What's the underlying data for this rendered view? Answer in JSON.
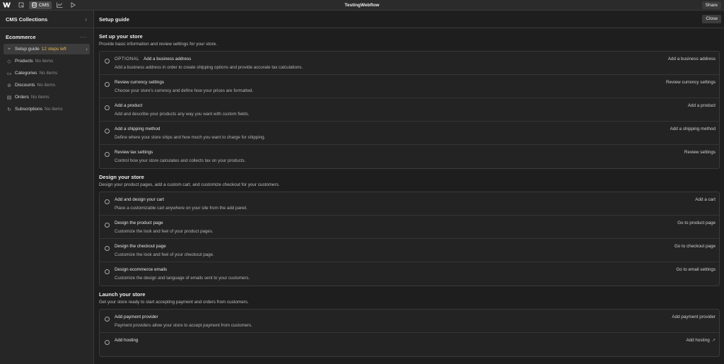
{
  "topbar": {
    "logo": "webflow-logo",
    "cms_label": "CMS",
    "title": "TestingWebflow",
    "share_label": "Share"
  },
  "sidebar": {
    "header_title": "CMS Collections",
    "section_title": "Ecommerce",
    "items": [
      {
        "label": "Setup guide",
        "count": "12 steps left",
        "icon": "pin-icon",
        "active": true
      },
      {
        "label": "Products",
        "count": "No items",
        "icon": "tag-icon"
      },
      {
        "label": "Categories",
        "count": "No items",
        "icon": "folder-icon"
      },
      {
        "label": "Discounts",
        "count": "No items",
        "icon": "discount-icon"
      },
      {
        "label": "Orders",
        "count": "No items",
        "icon": "receipt-icon"
      },
      {
        "label": "Subscriptions",
        "count": "No items",
        "icon": "refresh-icon"
      }
    ]
  },
  "main": {
    "title": "Setup guide",
    "close_label": "Close",
    "sections": [
      {
        "title": "Set up your store",
        "desc": "Provide basic information and review settings for your store.",
        "rows": [
          {
            "optional": "OPTIONAL",
            "title": "Add a business address",
            "desc": "Add a business address in order to create shipping options and provide accurate tax calculations.",
            "action": "Add a business address"
          },
          {
            "title": "Review currency settings",
            "desc": "Choose your store's currency and define how your prices are formatted.",
            "action": "Review currency settings"
          },
          {
            "title": "Add a product",
            "desc": "Add and describe your products any way you want with custom fields.",
            "action": "Add a product"
          },
          {
            "title": "Add a shipping method",
            "desc": "Define where your store ships and how much you want to charge for shipping.",
            "action": "Add a shipping method"
          },
          {
            "title": "Review tax settings",
            "desc": "Control how your store calculates and collects tax on your products.",
            "action": "Review settings"
          }
        ]
      },
      {
        "title": "Design your store",
        "desc": "Design your product pages, add a custom cart, and customize checkout for your customers.",
        "rows": [
          {
            "title": "Add and design your cart",
            "desc": "Place a customizable cart anywhere on your site from the add panel.",
            "action": "Add a cart"
          },
          {
            "title": "Design the product page",
            "desc": "Customize the look and feel of your product pages.",
            "action": "Go to product page"
          },
          {
            "title": "Design the checkout page",
            "desc": "Customize the look and feel of your checkout page.",
            "action": "Go to checkout page"
          },
          {
            "title": "Design ecommerce emails",
            "desc": "Customize the design and language of emails sent to your customers.",
            "action": "Go to email settings"
          }
        ]
      },
      {
        "title": "Launch your store",
        "desc": "Get your store ready to start accepting payment and orders from customers.",
        "rows": [
          {
            "title": "Add payment provider",
            "desc": "Payment providers allow your store to accept payment from customers.",
            "action": "Add payment provider"
          },
          {
            "title": "Add hosting",
            "desc": "",
            "action": "Add hosting",
            "external": true
          }
        ]
      }
    ]
  },
  "colors": {
    "background": "#1e1e1e",
    "panel": "#262626",
    "warning": "#e8b64a"
  }
}
